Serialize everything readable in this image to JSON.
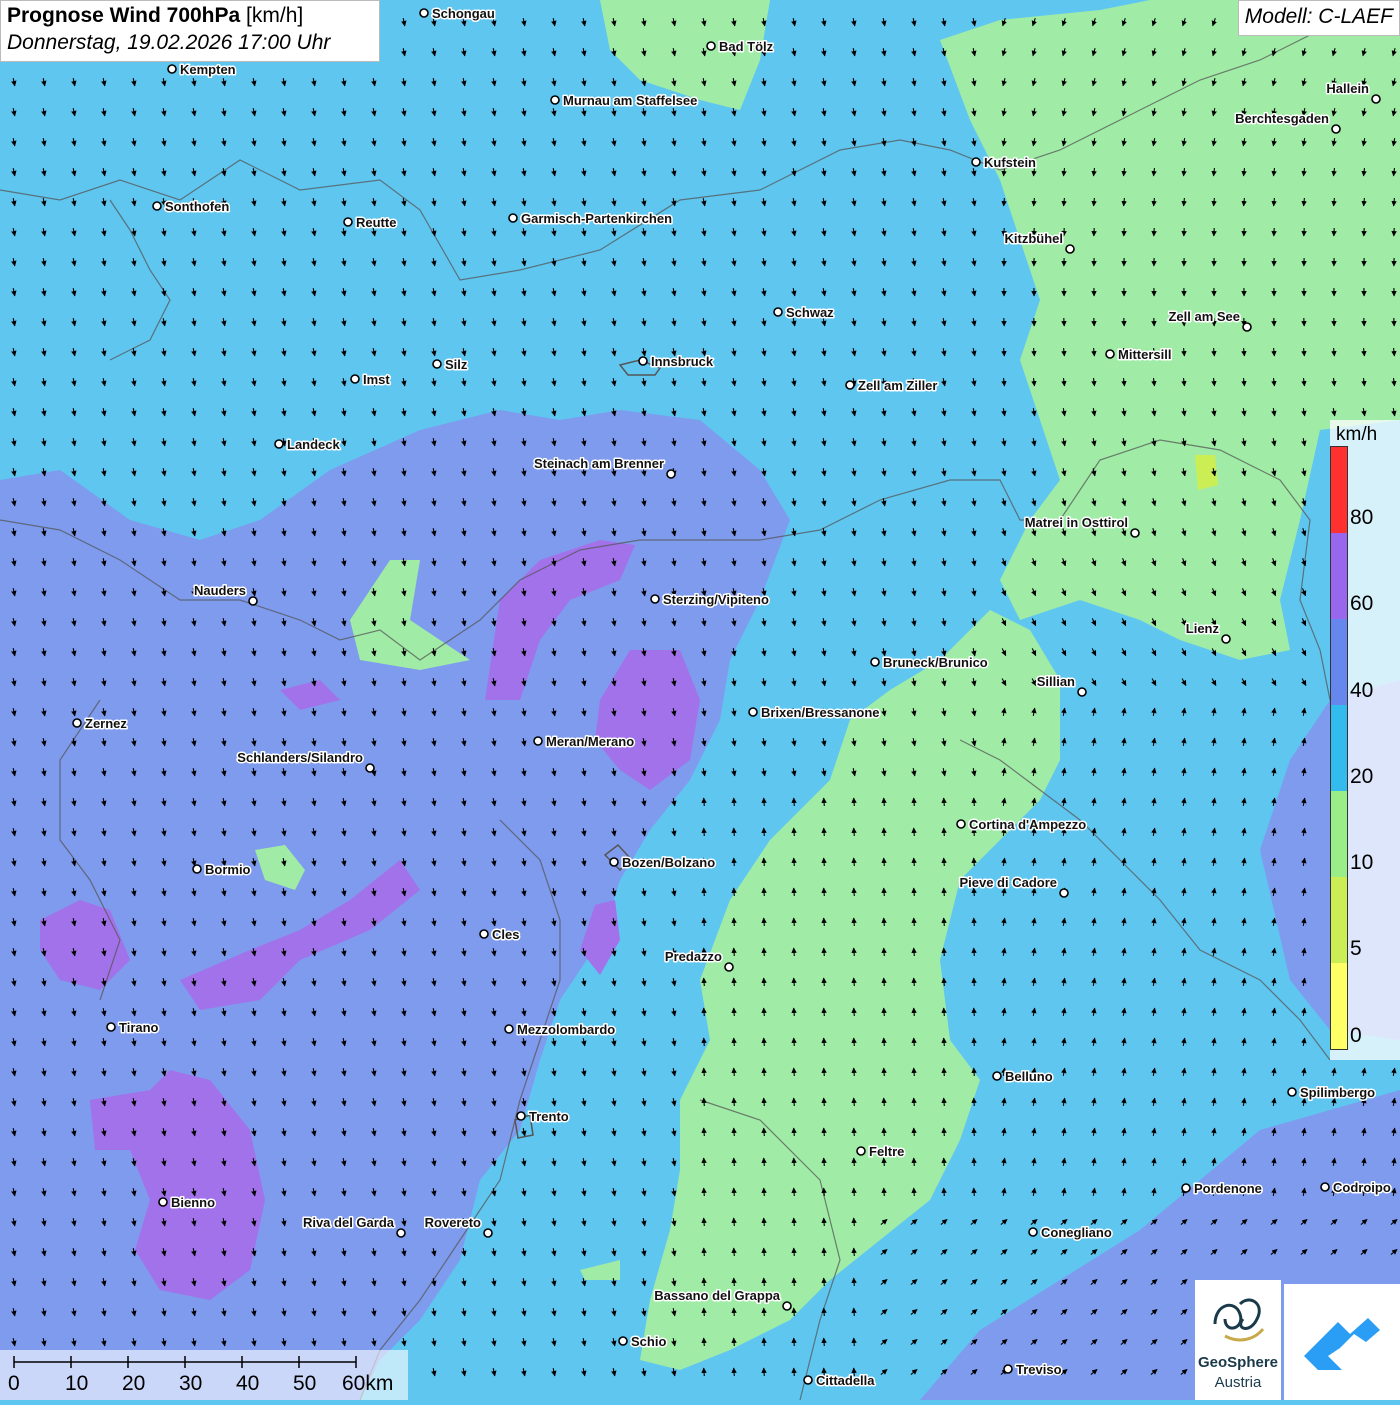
{
  "title": {
    "main": "Prognose Wind 700hPa",
    "unit": "[km/h]",
    "datetime": "Donnerstag, 19.02.2026 17:00 Uhr"
  },
  "model": "Modell: C-LAEF",
  "legend": {
    "unit": "km/h",
    "ticks": [
      "80",
      "60",
      "40",
      "20",
      "10",
      "5",
      "0"
    ],
    "colors_top_to_bottom": [
      "#ff3030",
      "#9966ee",
      "#6688ee",
      "#33bbee",
      "#99ee88",
      "#ccee55",
      "#ffff66"
    ]
  },
  "scale_bar": {
    "labels": [
      "0",
      "10",
      "20",
      "30",
      "40",
      "50",
      "60km"
    ]
  },
  "logo": {
    "line1": "GeoSphere",
    "line2": "Austria"
  },
  "cities": [
    {
      "name": "Schongau",
      "anchor": "right"
    },
    {
      "name": "Bad Tölz",
      "anchor": "right"
    },
    {
      "name": "Kempten",
      "anchor": "right"
    },
    {
      "name": "Murnau am Staffelsee",
      "anchor": "right"
    },
    {
      "name": "Hallein",
      "anchor": "left"
    },
    {
      "name": "Berchtesgaden",
      "anchor": "left"
    },
    {
      "name": "Kufstein",
      "anchor": "right"
    },
    {
      "name": "Sonthofen",
      "anchor": "right"
    },
    {
      "name": "Reutte",
      "anchor": "right"
    },
    {
      "name": "Garmisch-Partenkirchen",
      "anchor": "right"
    },
    {
      "name": "Kitzbühel",
      "anchor": "left"
    },
    {
      "name": "Schwaz",
      "anchor": "right"
    },
    {
      "name": "Zell am See",
      "anchor": "left"
    },
    {
      "name": "Mittersill",
      "anchor": "right"
    },
    {
      "name": "Innsbruck",
      "anchor": "right"
    },
    {
      "name": "Silz",
      "anchor": "right"
    },
    {
      "name": "Imst",
      "anchor": "right"
    },
    {
      "name": "Zell am Ziller",
      "anchor": "right"
    },
    {
      "name": "Landeck",
      "anchor": "right"
    },
    {
      "name": "Steinach am Brenner",
      "anchor": "left"
    },
    {
      "name": "Matrei in Osttirol",
      "anchor": "left"
    },
    {
      "name": "Nauders",
      "anchor": "left"
    },
    {
      "name": "Sterzing/Vipiteno",
      "anchor": "right"
    },
    {
      "name": "Lienz",
      "anchor": "left"
    },
    {
      "name": "Bruneck/Brunico",
      "anchor": "right"
    },
    {
      "name": "Sillian",
      "anchor": "left"
    },
    {
      "name": "Zernez",
      "anchor": "right"
    },
    {
      "name": "Brixen/Bressanone",
      "anchor": "right"
    },
    {
      "name": "Meran/Merano",
      "anchor": "right"
    },
    {
      "name": "Schlanders/Silandro",
      "anchor": "left"
    },
    {
      "name": "Cortina d'Ampezzo",
      "anchor": "right"
    },
    {
      "name": "Bozen/Bolzano",
      "anchor": "right"
    },
    {
      "name": "Bormio",
      "anchor": "right"
    },
    {
      "name": "Pieve di Cadore",
      "anchor": "left"
    },
    {
      "name": "Cles",
      "anchor": "right"
    },
    {
      "name": "Predazzo",
      "anchor": "left"
    },
    {
      "name": "Tirano",
      "anchor": "right"
    },
    {
      "name": "Mezzolombardo",
      "anchor": "right"
    },
    {
      "name": "Belluno",
      "anchor": "right"
    },
    {
      "name": "Spilimbergo",
      "anchor": "right"
    },
    {
      "name": "Trento",
      "anchor": "right"
    },
    {
      "name": "Feltre",
      "anchor": "right"
    },
    {
      "name": "Pordenone",
      "anchor": "right"
    },
    {
      "name": "Codroipo",
      "anchor": "right"
    },
    {
      "name": "Bienno",
      "anchor": "right"
    },
    {
      "name": "Riva del Garda",
      "anchor": "left"
    },
    {
      "name": "Rovereto",
      "anchor": "left"
    },
    {
      "name": "Conegliano",
      "anchor": "right"
    },
    {
      "name": "Bassano del Grappa",
      "anchor": "left"
    },
    {
      "name": "Schio",
      "anchor": "right"
    },
    {
      "name": "Treviso",
      "anchor": "right"
    },
    {
      "name": "Cittadella",
      "anchor": "right"
    }
  ]
}
